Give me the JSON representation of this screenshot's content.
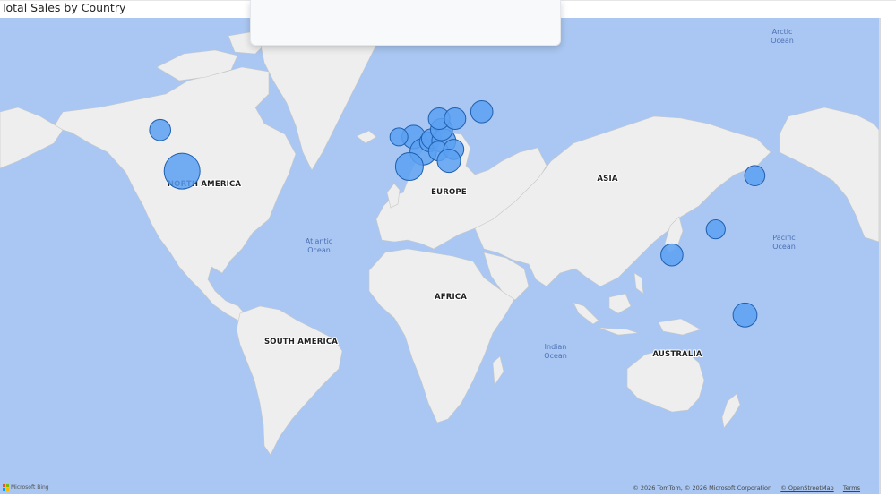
{
  "visual": {
    "title": "Total Sales by Country"
  },
  "map": {
    "ocean_labels": [
      {
        "line1": "Arctic",
        "line2": "Ocean"
      },
      {
        "line1": "Atlantic",
        "line2": "Ocean"
      },
      {
        "line1": "Pacific",
        "line2": "Ocean"
      },
      {
        "line1": "Indian",
        "line2": "Ocean"
      }
    ],
    "continent_labels": [
      "NORTH AMERICA",
      "EUROPE",
      "ASIA",
      "AFRICA",
      "SOUTH AMERICA",
      "AUSTRALIA"
    ],
    "bubble_color": "#5aa0f2",
    "bubble_stroke": "#1f5fae",
    "ocean_color": "#a9c7f2",
    "land_color": "#eeeeee",
    "bubbles": [
      {
        "id": "usa",
        "lon": -97,
        "lat": 38,
        "size": 1.0
      },
      {
        "id": "canada",
        "lon": -106,
        "lat": 56,
        "size": 0.35
      },
      {
        "id": "uk",
        "lon": -2,
        "lat": 53,
        "size": 0.42
      },
      {
        "id": "ireland",
        "lon": -8,
        "lat": 53,
        "size": 0.25
      },
      {
        "id": "france",
        "lon": 2,
        "lat": 46.5,
        "size": 0.55
      },
      {
        "id": "spain",
        "lon": -3.7,
        "lat": 40,
        "size": 0.6
      },
      {
        "id": "belgium",
        "lon": 4.5,
        "lat": 50.8,
        "size": 0.3
      },
      {
        "id": "netherlands",
        "lon": 5.3,
        "lat": 52.2,
        "size": 0.3
      },
      {
        "id": "germany",
        "lon": 10.4,
        "lat": 51.2,
        "size": 0.45
      },
      {
        "id": "denmark",
        "lon": 9.5,
        "lat": 56.2,
        "size": 0.38
      },
      {
        "id": "norway",
        "lon": 8.5,
        "lat": 61,
        "size": 0.36
      },
      {
        "id": "sweden",
        "lon": 15,
        "lat": 61,
        "size": 0.36
      },
      {
        "id": "finland",
        "lon": 26,
        "lat": 64,
        "size": 0.38
      },
      {
        "id": "switzerland",
        "lon": 8.2,
        "lat": 46.8,
        "size": 0.3
      },
      {
        "id": "austria",
        "lon": 14.5,
        "lat": 47.5,
        "size": 0.32
      },
      {
        "id": "italy",
        "lon": 12.5,
        "lat": 42.5,
        "size": 0.42
      },
      {
        "id": "japan",
        "lon": 138,
        "lat": 36,
        "size": 0.32
      },
      {
        "id": "philippines",
        "lon": 122,
        "lat": 12.5,
        "size": 0.28
      },
      {
        "id": "singapore",
        "lon": 104,
        "lat": 1.3,
        "size": 0.38
      },
      {
        "id": "australia",
        "lon": 134,
        "lat": -25,
        "size": 0.45
      }
    ]
  },
  "attribution": {
    "text": "© 2026 TomTom, © 2026 Microsoft Corporation",
    "osm_link": "© OpenStreetMap",
    "terms_link": "Terms"
  },
  "logo": {
    "text": "Microsoft Bing"
  }
}
